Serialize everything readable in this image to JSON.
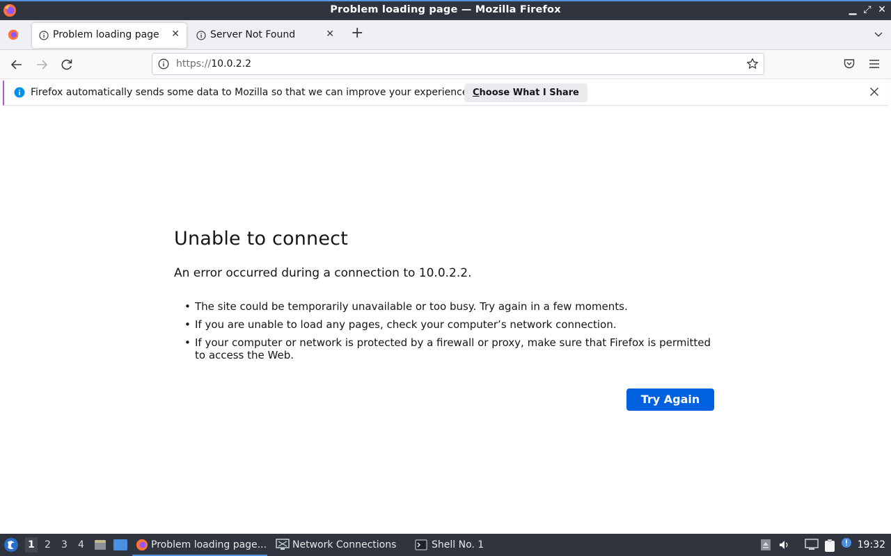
{
  "window": {
    "title": "Problem loading page — Mozilla Firefox",
    "minimize": "▁",
    "maximize": "⤢",
    "close": "✕"
  },
  "tabs": [
    {
      "label": "Problem loading page",
      "active": true
    },
    {
      "label": "Server Not Found",
      "active": false
    }
  ],
  "tab_close": "✕",
  "new_tab": "+",
  "urlbar": {
    "scheme": "https://",
    "host": "10.0.2.2"
  },
  "notification": {
    "message": "Firefox automatically sends some data to Mozilla so that we can improve your experience.",
    "button_first": "C",
    "button_rest": "hoose What I Share"
  },
  "error": {
    "title": "Unable to connect",
    "description": "An error occurred during a connection to 10.0.2.2.",
    "bullets": [
      "The site could be temporarily unavailable or too busy. Try again in a few moments.",
      "If you are unable to load any pages, check your computer’s network connection.",
      "If your computer or network is protected by a firewall or proxy, make sure that Firefox is permitted to access the Web."
    ],
    "button": "Try Again"
  },
  "taskbar": {
    "workspaces": [
      "1",
      "2",
      "3",
      "4"
    ],
    "active_workspace": "1",
    "items": [
      {
        "label": "Problem loading page...",
        "icon": "firefox-icon"
      },
      {
        "label": "Network Connections",
        "icon": "network-icon"
      },
      {
        "label": "Shell No. 1",
        "icon": "terminal-icon"
      }
    ],
    "clock": "19:32"
  },
  "colors": {
    "accent": "#0061e0",
    "titlebar": "#2f343f",
    "highlight": "#5294e2"
  }
}
